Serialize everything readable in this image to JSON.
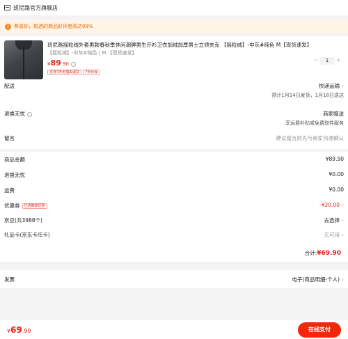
{
  "store": {
    "name": "班尼路官方旗舰店",
    "icon": "store-icon"
  },
  "tip": {
    "text": "恭喜你，挑选的商品好评度高达99%",
    "icon": "info-icon",
    "color": "#e06a0e"
  },
  "product": {
    "title": "班尼路摇粒绒外套男款春秋季休闲潮牌男生开衫卫衣加绒加厚男士立领夹克 【摇粒绒】-中灰#纯色 M【现货速发】",
    "spec": "【摇粒绒】-中灰#纯色 | M 【现货速发】",
    "price_symbol": "¥",
    "price_int": "89",
    "price_dec": ".90",
    "tags": [
      "支持7天无理由退货",
      "7天价保"
    ],
    "quantity": "1",
    "minus": "−",
    "plus": "+"
  },
  "delivery": {
    "label": "配送",
    "value": "快递运输",
    "detail": "预计1月14日发货，1月18日送达"
  },
  "returns": {
    "label": "退换无忧",
    "value": "商家赠送",
    "detail": "享运费补贴或免费取件服务"
  },
  "message": {
    "label": "留言",
    "placeholder": "建议留言前先与商家沟通确认"
  },
  "summary": {
    "goods": {
      "label": "商品金额",
      "value": "¥89.90"
    },
    "returns": {
      "label": "退换无忧",
      "value": "¥0.00"
    },
    "shipping": {
      "label": "运费",
      "value": "¥0.00"
    },
    "coupon": {
      "label": "优惠券",
      "tag": "已选推荐优惠",
      "value": "-¥20.00"
    },
    "jingdou": {
      "label": "京豆(共3988个)",
      "value": "去选择"
    },
    "giftcard": {
      "label": "礼品卡(京东卡/E卡)",
      "value": "无可用"
    },
    "total_label": "合计:",
    "total_symbol": "¥",
    "total_amount": "69.90"
  },
  "invoice": {
    "label": "发票",
    "value": "电子(商品明细-个人)"
  },
  "bottom": {
    "symbol": "¥",
    "int": "69",
    "dec": ".90",
    "pay_label": "在线支付"
  },
  "colors": {
    "accent": "#e2231a",
    "pay": "#f2270c",
    "tip_bg": "#fff4e5"
  }
}
